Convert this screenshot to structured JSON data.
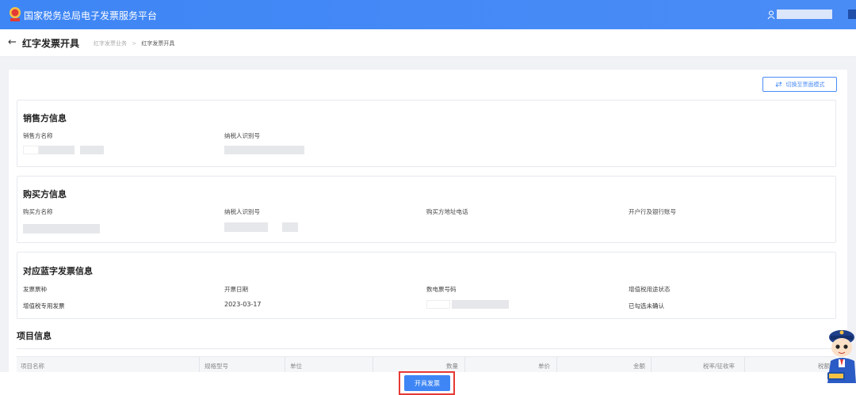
{
  "header": {
    "brand": "国家税务总局电子发票服务平台",
    "user_icon": "user-icon"
  },
  "subheader": {
    "back_icon": "arrow-left-icon",
    "title": "红字发票开具",
    "breadcrumb": [
      "红字发票业务",
      "红字发票开具"
    ],
    "breadcrumb_sep": ">"
  },
  "main": {
    "switch_button": "切换至票面模式",
    "switch_icon": "swap-icon",
    "seller": {
      "title": "销售方信息",
      "name_label": "销售方名称",
      "tax_id_label": "纳税人识别号"
    },
    "buyer": {
      "title": "购买方信息",
      "name_label": "购买方名称",
      "tax_id_label": "纳税人识别号",
      "address_label": "购买方地址电话",
      "bank_label": "开户行及银行账号"
    },
    "blue_invoice": {
      "title": "对应蓝字发票信息",
      "type_label": "发票票种",
      "type_value": "增值税专用发票",
      "date_label": "开票日期",
      "date_value": "2023-03-17",
      "number_label": "数电票号码",
      "status_label": "增值税用途状态",
      "status_value": "已勾选未确认"
    },
    "items": {
      "title": "项目信息",
      "columns": [
        "项目名称",
        "规格型号",
        "单位",
        "数量",
        "单价",
        "金额",
        "税率/征收率",
        "税额"
      ]
    }
  },
  "footer": {
    "issue_button": "开具发票"
  },
  "colors": {
    "primary": "#3e86f5",
    "highlight": "#e53935"
  }
}
